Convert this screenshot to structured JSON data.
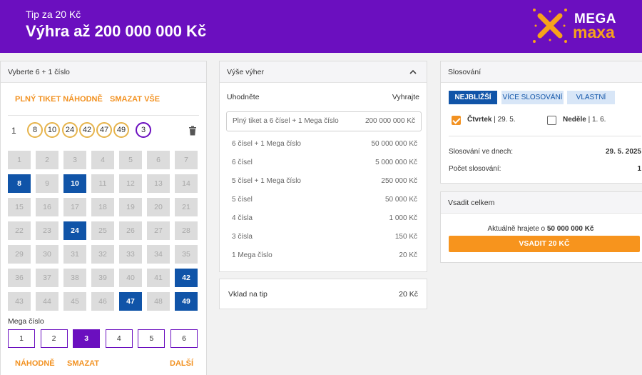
{
  "header": {
    "subtitle": "Tip za 20 Kč",
    "title": "Výhra až 200 000 000 Kč",
    "logo_top": "MEGA",
    "logo_bottom": "maxa"
  },
  "ticket": {
    "panel_title": "Vyberte 6 + 1 číslo",
    "random_full": "PLNÝ TIKET NÁHODNĚ",
    "clear_all": "SMAZAT VŠE",
    "ticket_number": "1",
    "picked": [
      "8",
      "10",
      "24",
      "42",
      "47",
      "49"
    ],
    "picked_mega": "3",
    "numbers": [
      "1",
      "2",
      "3",
      "4",
      "5",
      "6",
      "7",
      "8",
      "9",
      "10",
      "11",
      "12",
      "13",
      "14",
      "15",
      "16",
      "17",
      "18",
      "19",
      "20",
      "21",
      "22",
      "23",
      "24",
      "25",
      "26",
      "27",
      "28",
      "29",
      "30",
      "31",
      "32",
      "33",
      "34",
      "35",
      "36",
      "37",
      "38",
      "39",
      "40",
      "41",
      "42",
      "43",
      "44",
      "45",
      "46",
      "47",
      "48",
      "49"
    ],
    "selected": [
      8,
      10,
      24,
      42,
      47,
      49
    ],
    "mega_label": "Mega číslo",
    "mega_numbers": [
      "1",
      "2",
      "3",
      "4",
      "5",
      "6"
    ],
    "mega_selected": 3,
    "random": "NÁHODNĚ",
    "clear": "SMAZAT",
    "next": "DALŠÍ"
  },
  "wins": {
    "panel_title": "Výše výher",
    "col_guess": "Uhodněte",
    "col_win": "Vyhrajte",
    "jackpot_label": "Plný tiket a 6 čísel + 1 Mega číslo",
    "jackpot_value": "200 000 000 Kč",
    "rows": [
      {
        "label": "6 čísel + 1 Mega číslo",
        "value": "50 000 000 Kč"
      },
      {
        "label": "6 čísel",
        "value": "5 000 000 Kč"
      },
      {
        "label": "5 čísel + 1 Mega číslo",
        "value": "250 000 Kč"
      },
      {
        "label": "5 čísel",
        "value": "50 000 Kč"
      },
      {
        "label": "4 čísla",
        "value": "1 000 Kč"
      },
      {
        "label": "3 čísla",
        "value": "150 Kč"
      },
      {
        "label": "1 Mega číslo",
        "value": "20 Kč"
      }
    ]
  },
  "stake": {
    "label": "Vklad na tip",
    "value": "20 Kč"
  },
  "draw": {
    "panel_title": "Slosování",
    "tabs": [
      "NEJBLIŽŠÍ",
      "VÍCE SLOSOVÁNÍ",
      "VLASTNÍ"
    ],
    "active_tab": 0,
    "day1_name": "Čtvrtek",
    "day1_date": " | 29. 5.",
    "day1_checked": true,
    "day2_name": "Neděle",
    "day2_date": " | 1. 6.",
    "day2_checked": false,
    "days_label": "Slosování ve dnech:",
    "days_value": "29. 5. 2025",
    "count_label": "Počet slosování:",
    "count_value": "1"
  },
  "total": {
    "panel_title": "Vsadit celkem",
    "playing_prefix": "Aktuálně hrajete o ",
    "playing_amount": "50 000 000 Kč",
    "bet_button": "VSADIT 20 KČ"
  },
  "colors": {
    "brand_purple": "#6b0fbf",
    "accent_orange": "#f29222",
    "selected_blue": "#1054a8"
  }
}
